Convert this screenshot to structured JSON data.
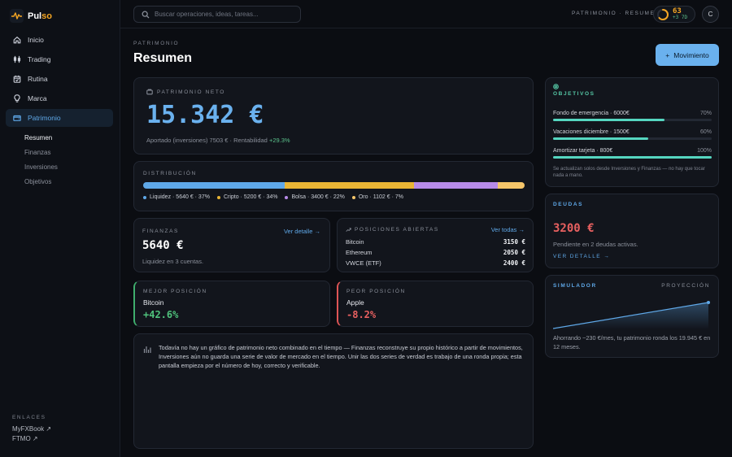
{
  "brand": {
    "name_plain": "Pul",
    "name_accent": "so"
  },
  "sidebar": {
    "items": [
      {
        "label": "Inicio",
        "icon": "home-icon"
      },
      {
        "label": "Trading",
        "icon": "candles-icon"
      },
      {
        "label": "Rutina",
        "icon": "calendar-icon"
      },
      {
        "label": "Marca",
        "icon": "bulb-icon"
      },
      {
        "label": "Patrimonio",
        "icon": "wallet-icon",
        "active": true
      }
    ],
    "subitems": [
      {
        "label": "Resumen",
        "active": true
      },
      {
        "label": "Finanzas"
      },
      {
        "label": "Inversiones"
      },
      {
        "label": "Objetivos"
      }
    ],
    "links_title": "ENLACES",
    "links": [
      "MyFXBook ↗",
      "FTMO ↗"
    ]
  },
  "topbar": {
    "search_placeholder": "Buscar operaciones, ideas, tareas...",
    "breadcrumb": "PATRIMONIO · RESUMEN",
    "streak_value": "63",
    "streak_sub": "+3 7D",
    "streak_progress": 0.63,
    "avatar_initial": "C"
  },
  "page": {
    "eyebrow": "PATRIMONIO",
    "title": "Resumen",
    "primary_button": "Movimiento",
    "primary_button_icon": "+"
  },
  "net_worth": {
    "label": "PATRIMONIO NETO",
    "value": "15.342 €",
    "sub_prefix": "Aportado (inversiones) 7503 € · Rentabilidad",
    "sub_return": "+29.3%"
  },
  "distribution": {
    "label": "DISTRIBUCIÓN",
    "segments": [
      {
        "label": "Liquidez · 5640 € · 37%",
        "share": 37,
        "color": "#5fa8e8"
      },
      {
        "label": "Cripto · 5200 € · 34%",
        "share": 34,
        "color": "#e9b535"
      },
      {
        "label": "Bolsa · 3400 € · 22%",
        "share": 22,
        "color": "#b78be8"
      },
      {
        "label": "Oro · 1102 € · 7%",
        "share": 7,
        "color": "#f5c66a"
      }
    ]
  },
  "finances": {
    "label": "FINANZAS",
    "link": "Ver detalle →",
    "value": "5640 €",
    "sub": "Liquidez en 3 cuentas."
  },
  "positions": {
    "label": "POSICIONES ABIERTAS",
    "link": "Ver todas →",
    "rows": [
      {
        "name": "Bitcoin",
        "value": "3150 €"
      },
      {
        "name": "Ethereum",
        "value": "2050 €"
      },
      {
        "name": "VWCE (ETF)",
        "value": "2400 €"
      }
    ]
  },
  "best": {
    "label": "MEJOR POSICIÓN",
    "name": "Bitcoin",
    "value": "+42.6%"
  },
  "worst": {
    "label": "PEOR POSICIÓN",
    "name": "Apple",
    "value": "-8.2%"
  },
  "note": {
    "text": "Todavía no hay un gráfico de patrimonio neto combinado en el tiempo — Finanzas reconstruye su propio histórico a partir de movimientos, Inversiones aún no guarda una serie de valor de mercado en el tiempo. Unir las dos series de verdad es trabajo de una ronda propia; esta pantalla empieza por el número de hoy, correcto y verificable."
  },
  "goals": {
    "label": "OBJETIVOS",
    "items": [
      {
        "label": "Fondo de emergencia · 6000€",
        "pct_text": "70%",
        "pct": 70
      },
      {
        "label": "Vacaciones diciembre · 1500€",
        "pct_text": "60%",
        "pct": 60
      },
      {
        "label": "Amortizar tarjeta · 800€",
        "pct_text": "100%",
        "pct": 100
      }
    ],
    "note": "Se actualizan solos desde Inversiones y Finanzas — no hay que tocar nada a mano."
  },
  "debts": {
    "label": "DEUDAS",
    "value": "3200 €",
    "sub": "Pendiente en 2 deudas activas.",
    "link": "VER DETALLE →"
  },
  "simulator": {
    "label": "SIMULADOR",
    "label_right": "PROYECCIÓN",
    "text": "Ahorrando ~230 €/mes, tu patrimonio ronda los 19.945 € en 12 meses."
  },
  "colors": {
    "accent": "#5fa8e8",
    "positive": "#4fc27c",
    "negative": "#e86060",
    "streak": "#f5a623",
    "teal": "#55c7a5"
  }
}
